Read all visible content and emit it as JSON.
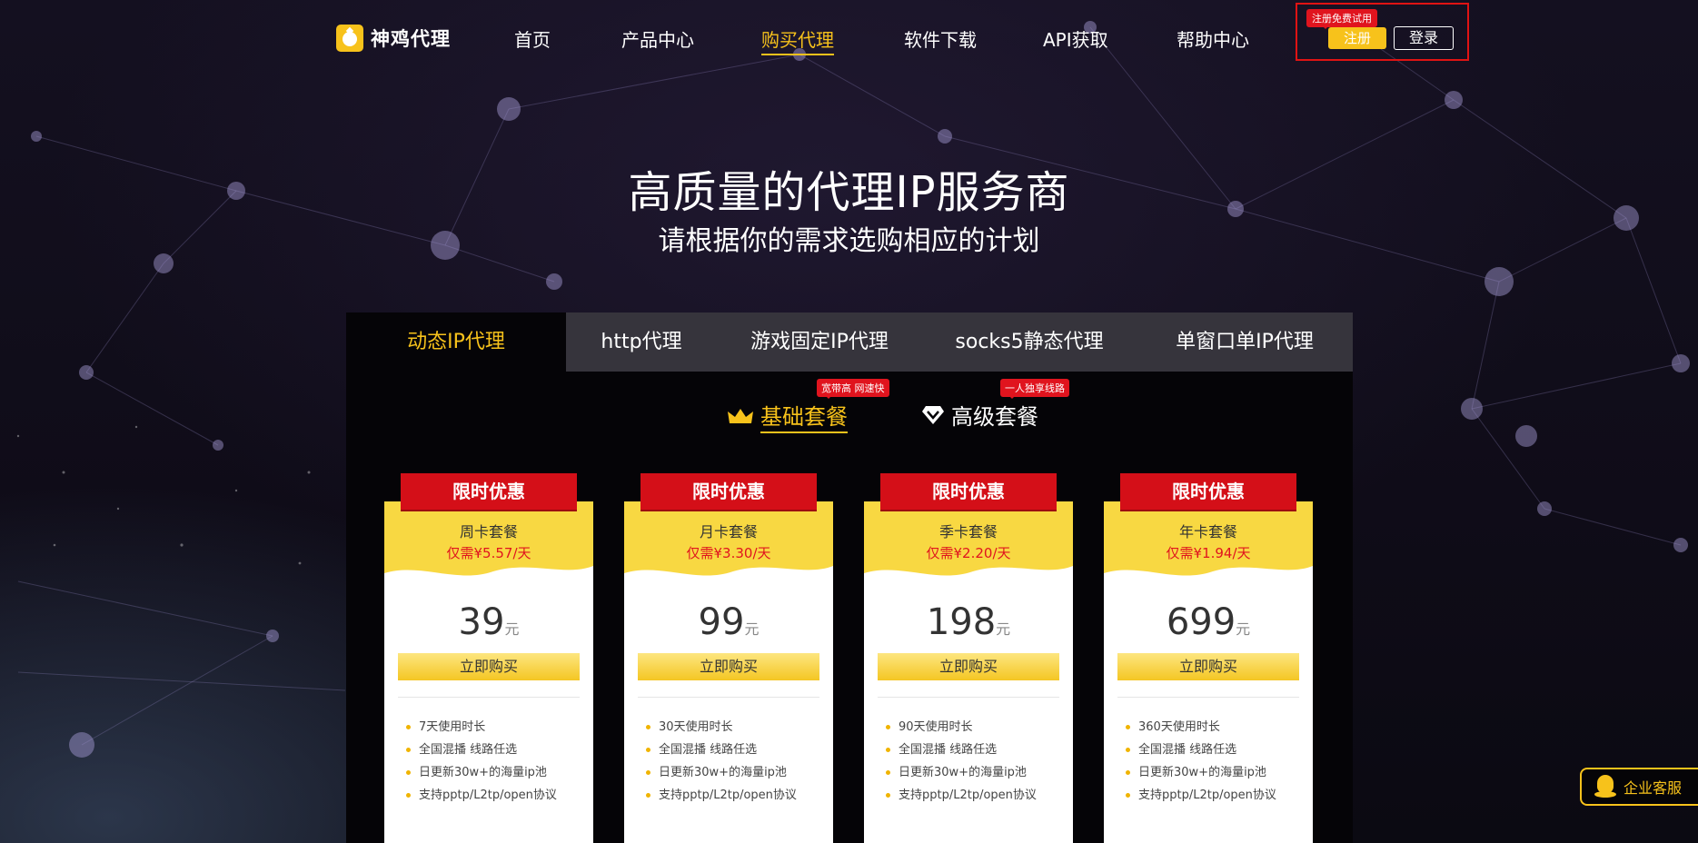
{
  "brand": {
    "name": "神鸡代理"
  },
  "nav": {
    "items": [
      {
        "label": "首页"
      },
      {
        "label": "产品中心"
      },
      {
        "label": "购买代理",
        "active": true
      },
      {
        "label": "软件下载"
      },
      {
        "label": "API获取"
      },
      {
        "label": "帮助中心"
      }
    ],
    "trial_badge": "注册免费试用",
    "register_label": "注册",
    "login_label": "登录"
  },
  "hero": {
    "title": "高质量的代理IP服务商",
    "subtitle": "请根据你的需求选购相应的计划"
  },
  "tabs": [
    {
      "label": "动态IP代理",
      "active": true
    },
    {
      "label": "http代理"
    },
    {
      "label": "游戏固定IP代理"
    },
    {
      "label": "socks5静态代理"
    },
    {
      "label": "单窗口单IP代理"
    }
  ],
  "packages": {
    "basic": {
      "label": "基础套餐",
      "tag": "宽带高 网速快",
      "icon": "crown-icon"
    },
    "advanced": {
      "label": "高级套餐",
      "tag": "一人独享线路",
      "icon": "diamond-icon"
    }
  },
  "cards": [
    {
      "ribbon": "限时优惠",
      "name": "周卡套餐",
      "daily": "仅需¥5.57/天",
      "price": "39",
      "unit": "元",
      "buy_label": "立即购买",
      "features": [
        "7天使用时长",
        "全国混播 线路任选",
        "日更新30w+的海量ip池",
        "支持pptp/L2tp/open协议"
      ]
    },
    {
      "ribbon": "限时优惠",
      "name": "月卡套餐",
      "daily": "仅需¥3.30/天",
      "price": "99",
      "unit": "元",
      "buy_label": "立即购买",
      "features": [
        "30天使用时长",
        "全国混播 线路任选",
        "日更新30w+的海量ip池",
        "支持pptp/L2tp/open协议"
      ]
    },
    {
      "ribbon": "限时优惠",
      "name": "季卡套餐",
      "daily": "仅需¥2.20/天",
      "price": "198",
      "unit": "元",
      "buy_label": "立即购买",
      "features": [
        "90天使用时长",
        "全国混播 线路任选",
        "日更新30w+的海量ip池",
        "支持pptp/L2tp/open协议"
      ]
    },
    {
      "ribbon": "限时优惠",
      "name": "年卡套餐",
      "daily": "仅需¥1.94/天",
      "price": "699",
      "unit": "元",
      "buy_label": "立即购买",
      "features": [
        "360天使用时长",
        "全国混播 线路任选",
        "日更新30w+的海量ip池",
        "支持pptp/L2tp/open协议"
      ]
    }
  ],
  "service": {
    "label": "企业客服",
    "icon": "qq-icon"
  },
  "colors": {
    "accent": "#f7c21b",
    "red": "#e0141e",
    "background": "#0d0b14"
  }
}
